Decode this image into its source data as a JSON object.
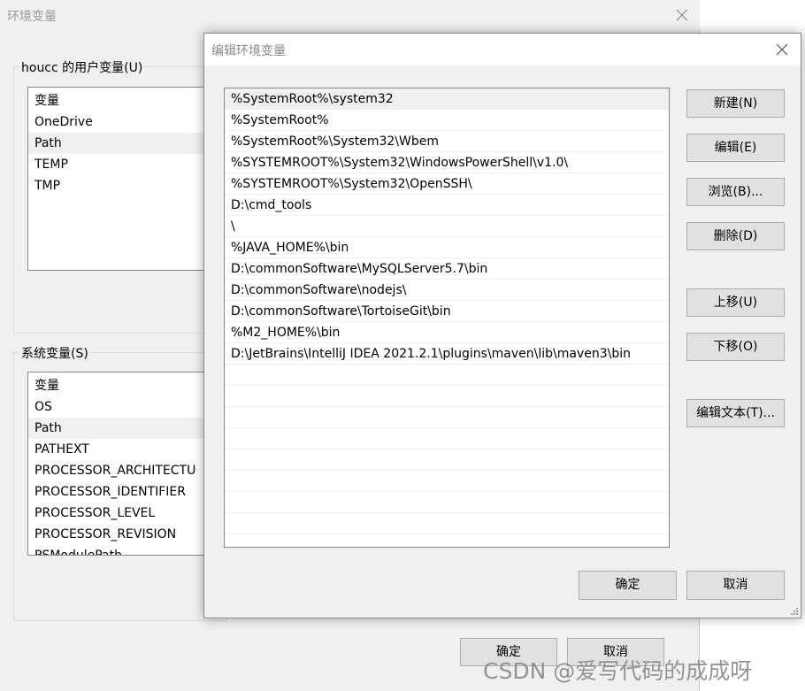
{
  "background_dialog": {
    "title": "环境变量",
    "user_vars": {
      "label": "houcc 的用户变量(U)",
      "header": "变量",
      "items": [
        "OneDrive",
        "Path",
        "TEMP",
        "TMP"
      ]
    },
    "system_vars": {
      "label": "系统变量(S)",
      "header": "变量",
      "items": [
        "OS",
        "Path",
        "PATHEXT",
        "PROCESSOR_ARCHITECTU",
        "PROCESSOR_IDENTIFIER",
        "PROCESSOR_LEVEL",
        "PROCESSOR_REVISION",
        "PSModulePath"
      ]
    },
    "ok_label": "确定",
    "cancel_label": "取消"
  },
  "edit_dialog": {
    "title": "编辑环境变量",
    "paths": [
      "%SystemRoot%\\system32",
      "%SystemRoot%",
      "%SystemRoot%\\System32\\Wbem",
      "%SYSTEMROOT%\\System32\\WindowsPowerShell\\v1.0\\",
      "%SYSTEMROOT%\\System32\\OpenSSH\\",
      "D:\\cmd_tools",
      "\\",
      "%JAVA_HOME%\\bin",
      "D:\\commonSoftware\\MySQLServer5.7\\bin",
      "D:\\commonSoftware\\nodejs\\",
      "D:\\commonSoftware\\TortoiseGit\\bin",
      "%M2_HOME%\\bin",
      "D:\\JetBrains\\IntelliJ IDEA 2021.2.1\\plugins\\maven\\lib\\maven3\\bin",
      "",
      "",
      "",
      "",
      "",
      "",
      "",
      ""
    ],
    "buttons": {
      "new": "新建(N)",
      "edit": "编辑(E)",
      "browse": "浏览(B)...",
      "delete": "删除(D)",
      "move_up": "上移(U)",
      "move_down": "下移(O)",
      "edit_text": "编辑文本(T)...",
      "ok": "确定",
      "cancel": "取消"
    }
  },
  "watermark": "CSDN @爱写代码的成成呀"
}
